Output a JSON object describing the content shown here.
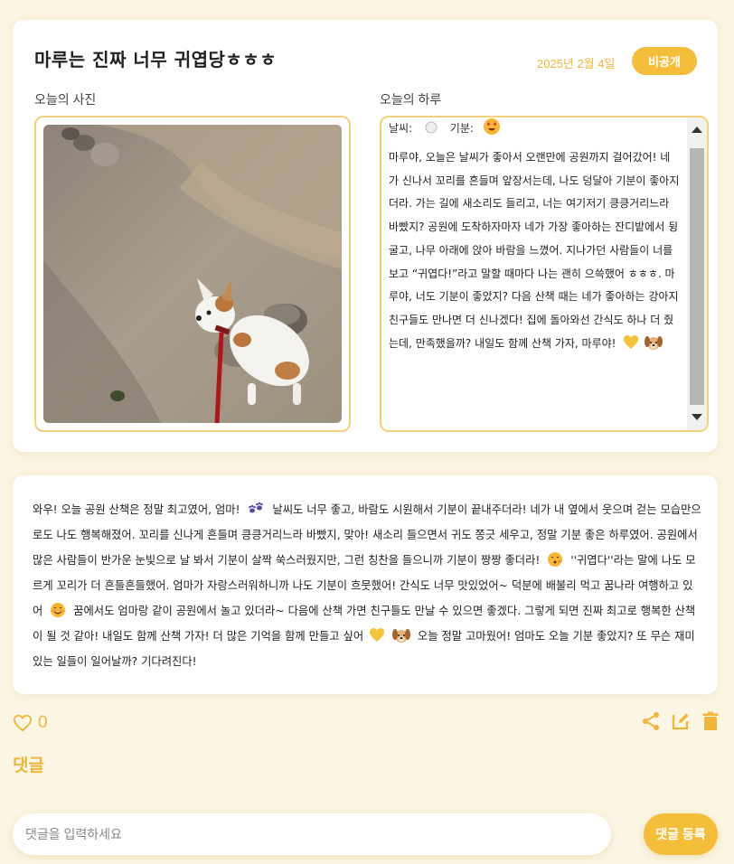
{
  "diary": {
    "title": "마루는 진짜 너무 귀엽당ㅎㅎㅎ",
    "date": "2025년 2월 4일",
    "visibility_label": "비공개",
    "photo_label": "오늘의 사진",
    "story_label": "오늘의 하루",
    "weather_label": "날씨:",
    "mood_label": "기분:",
    "weather_icon": "sun-icon",
    "mood_icon": "heart-eyes-emoji-icon",
    "story_text": "마루야, 오늘은 날씨가 좋아서 오랜만에 공원까지 걸어갔어! 네가 신나서 꼬리를 흔들며 앞장서는데, 나도 덩달아 기분이 좋아지더라. 가는 길에 새소리도 들리고, 너는 여기저기 킁킁거리느라 바빴지? 공원에 도착하자마자 네가 가장 좋아하는 잔디밭에서 뒹굴고, 나무 아래에 앉아 바람을 느꼈어. 지나가던 사람들이 너를 보고 “귀엽다!”라고 말할 때마다 나는 괜히 으쓱했어 ㅎㅎㅎ. 마루야, 너도 기분이 좋았지? 다음 산책 때는 네가 좋아하는 강아지 친구들도 만나면 더 신나겠다! 집에 돌아와선 간식도 하나 더 줬는데, 만족했을까? 내일도 함께 산책 가자, 마루야!",
    "story_emojis": [
      "yellow-heart-emoji-icon",
      "dog-face-emoji-icon"
    ]
  },
  "ai_reply": {
    "part1": "와우! 오늘 공원 산책은 정말 최고였어, 엄마!",
    "part2": "날씨도 너무 좋고, 바람도 시원해서 기분이 끝내주더라! 네가 내 옆에서 웃으며 걷는 모습만으로도 나도 행복해졌어. 꼬리를 신나게 흔들며 킁킁거리느라 바빴지, 맞아! 새소리 들으면서 귀도 쫑긋 세우고, 정말 기분 좋은 하루였어. 공원에서 많은 사람들이 반가운 눈빛으로 날 봐서 기분이 살짝 쑥스러웠지만, 그런 칭찬을 들으니까 기분이 짱짱 좋더라!",
    "part3": "''귀엽다''라는 말에 나도 모르게 꼬리가 더 흔들흔들했어. 엄마가 자랑스러워하니까 나도 기분이 흐뭇했어! 간식도 너무 맛있었어~ 덕분에 배불리 먹고 꿈나라 여행하고 있어",
    "part4": "꿈에서도 엄마랑 같이 공원에서 놀고 있더라~ 다음에 산책 가면 친구들도 만날 수 있으면 좋겠다. 그렇게 되면 진짜 최고로 행복한 산책이 될 것 같아! 내일도 함께 산책 가자! 더 많은 기억을 함께 만들고 싶어",
    "part5": "오늘 정말 고마웠어! 엄마도 오늘 기분 좋았지? 또 무슨 재미있는 일들이 일어날까? 기다려진다!",
    "emojis": [
      "paw-prints-emoji-icon",
      "kissing-face-emoji-icon",
      "smiling-face-emoji-icon",
      "yellow-heart-emoji-icon",
      "dog-face-emoji-icon"
    ]
  },
  "actions": {
    "like_count": "0",
    "like_icon": "heart-outline-icon",
    "share_icon": "share-icon",
    "edit_icon": "edit-icon",
    "delete_icon": "trash-icon"
  },
  "comments": {
    "heading": "댓글",
    "input_placeholder": "댓글을 입력하세요",
    "input_value": "",
    "submit_label": "댓글 등록"
  },
  "colors": {
    "accent": "#f4be3b",
    "accent_text": "#f0b63b",
    "border": "#f1d27a",
    "background": "#fbf5e3"
  }
}
